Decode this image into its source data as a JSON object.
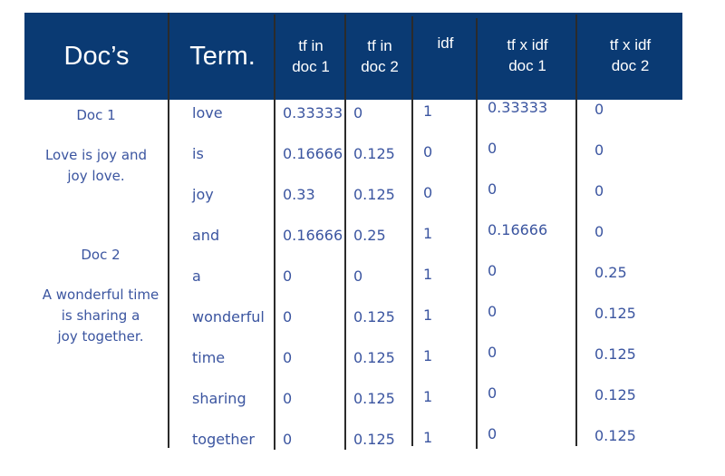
{
  "table": {
    "headers": {
      "docs": "Doc’s",
      "term": "Term.",
      "tf1": [
        "tf in",
        "doc 1"
      ],
      "tf2": [
        "tf in",
        "doc 2"
      ],
      "idf": "idf",
      "tfidf1": [
        "tf x idf",
        "doc 1"
      ],
      "tfidf2": [
        "tf x idf",
        "doc 2"
      ]
    },
    "documents": [
      {
        "label": "Doc 1",
        "text": [
          "Love is joy and",
          "joy love."
        ]
      },
      {
        "label": "Doc 2",
        "text": [
          "A wonderful time",
          "is sharing a",
          "joy together."
        ]
      }
    ],
    "rows": [
      {
        "term": "love",
        "tf1": "0.33333",
        "tf2": "0",
        "idf": "1",
        "tfidf1": "0.33333",
        "tfidf2": "0"
      },
      {
        "term": "is",
        "tf1": "0.16666",
        "tf2": "0.125",
        "idf": "0",
        "tfidf1": "0",
        "tfidf2": "0"
      },
      {
        "term": "joy",
        "tf1": "0.33",
        "tf2": "0.125",
        "idf": "0",
        "tfidf1": "0",
        "tfidf2": "0"
      },
      {
        "term": "and",
        "tf1": "0.16666",
        "tf2": "0.25",
        "idf": "1",
        "tfidf1": "0.16666",
        "tfidf2": "0"
      },
      {
        "term": "a",
        "tf1": "0",
        "tf2": "0",
        "idf": "1",
        "tfidf1": "0",
        "tfidf2": "0.25"
      },
      {
        "term": "wonderful",
        "tf1": "0",
        "tf2": "0.125",
        "idf": "1",
        "tfidf1": "0",
        "tfidf2": "0.125"
      },
      {
        "term": "time",
        "tf1": "0",
        "tf2": "0.125",
        "idf": "1",
        "tfidf1": "0",
        "tfidf2": "0.125"
      },
      {
        "term": "sharing",
        "tf1": "0",
        "tf2": "0.125",
        "idf": "1",
        "tfidf1": "0",
        "tfidf2": "0.125"
      },
      {
        "term": "together",
        "tf1": "0",
        "tf2": "0.125",
        "idf": "1",
        "tfidf1": "0",
        "tfidf2": "0.125"
      }
    ],
    "colors": {
      "header_bg": "#0a3a73",
      "header_text": "#ffffff",
      "body_text": "#3b55a0",
      "rule": "#2b2b2b"
    }
  }
}
